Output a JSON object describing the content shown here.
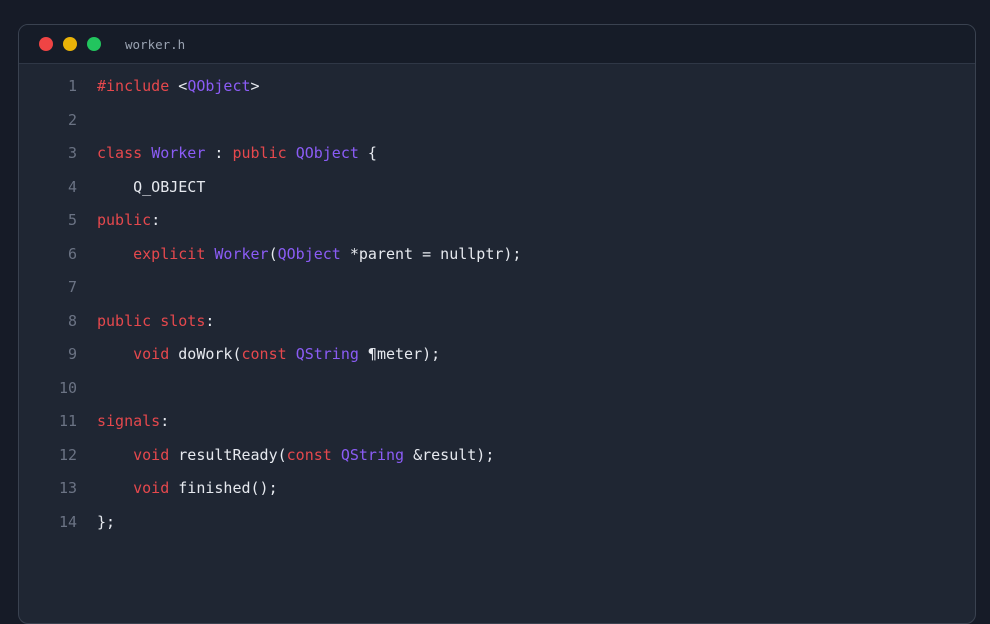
{
  "window": {
    "filename": "worker.h",
    "traffic_lights": [
      "close",
      "minimize",
      "maximize"
    ]
  },
  "colors": {
    "keyword": "#e5484d",
    "type": "#8b5cf6",
    "plain": "#e6e9ef",
    "line_number": "#6b7384",
    "background": "#1f2633"
  },
  "code": {
    "lines": [
      {
        "n": "1",
        "tokens": [
          {
            "t": "#include",
            "k": "kw"
          },
          {
            "t": " <",
            "k": "pl"
          },
          {
            "t": "QObject",
            "k": "ty"
          },
          {
            "t": ">",
            "k": "pl"
          }
        ]
      },
      {
        "n": "2",
        "tokens": []
      },
      {
        "n": "3",
        "tokens": [
          {
            "t": "class",
            "k": "kw"
          },
          {
            "t": " ",
            "k": "pl"
          },
          {
            "t": "Worker",
            "k": "ty"
          },
          {
            "t": " : ",
            "k": "pl"
          },
          {
            "t": "public",
            "k": "kw"
          },
          {
            "t": " ",
            "k": "pl"
          },
          {
            "t": "QObject",
            "k": "ty"
          },
          {
            "t": " {",
            "k": "pl"
          }
        ]
      },
      {
        "n": "4",
        "tokens": [
          {
            "t": "    Q_OBJECT",
            "k": "pl"
          }
        ]
      },
      {
        "n": "5",
        "tokens": [
          {
            "t": "public",
            "k": "kw"
          },
          {
            "t": ":",
            "k": "pl"
          }
        ]
      },
      {
        "n": "6",
        "tokens": [
          {
            "t": "    ",
            "k": "pl"
          },
          {
            "t": "explicit",
            "k": "kw"
          },
          {
            "t": " ",
            "k": "pl"
          },
          {
            "t": "Worker",
            "k": "ty"
          },
          {
            "t": "(",
            "k": "pl"
          },
          {
            "t": "QObject",
            "k": "ty"
          },
          {
            "t": " *parent = nullptr);",
            "k": "pl"
          }
        ]
      },
      {
        "n": "7",
        "tokens": []
      },
      {
        "n": "8",
        "tokens": [
          {
            "t": "public",
            "k": "kw"
          },
          {
            "t": " ",
            "k": "pl"
          },
          {
            "t": "slots",
            "k": "kw"
          },
          {
            "t": ":",
            "k": "pl"
          }
        ]
      },
      {
        "n": "9",
        "tokens": [
          {
            "t": "    ",
            "k": "pl"
          },
          {
            "t": "void",
            "k": "kw"
          },
          {
            "t": " doWork(",
            "k": "pl"
          },
          {
            "t": "const",
            "k": "kw"
          },
          {
            "t": " ",
            "k": "pl"
          },
          {
            "t": "QString",
            "k": "ty"
          },
          {
            "t": " ¶meter);",
            "k": "pl"
          }
        ]
      },
      {
        "n": "10",
        "tokens": []
      },
      {
        "n": "11",
        "tokens": [
          {
            "t": "signals",
            "k": "kw"
          },
          {
            "t": ":",
            "k": "pl"
          }
        ]
      },
      {
        "n": "12",
        "tokens": [
          {
            "t": "    ",
            "k": "pl"
          },
          {
            "t": "void",
            "k": "kw"
          },
          {
            "t": " resultReady(",
            "k": "pl"
          },
          {
            "t": "const",
            "k": "kw"
          },
          {
            "t": " ",
            "k": "pl"
          },
          {
            "t": "QString",
            "k": "ty"
          },
          {
            "t": " &result);",
            "k": "pl"
          }
        ]
      },
      {
        "n": "13",
        "tokens": [
          {
            "t": "    ",
            "k": "pl"
          },
          {
            "t": "void",
            "k": "kw"
          },
          {
            "t": " finished();",
            "k": "pl"
          }
        ]
      },
      {
        "n": "14",
        "tokens": [
          {
            "t": "};",
            "k": "pl"
          }
        ]
      }
    ]
  }
}
